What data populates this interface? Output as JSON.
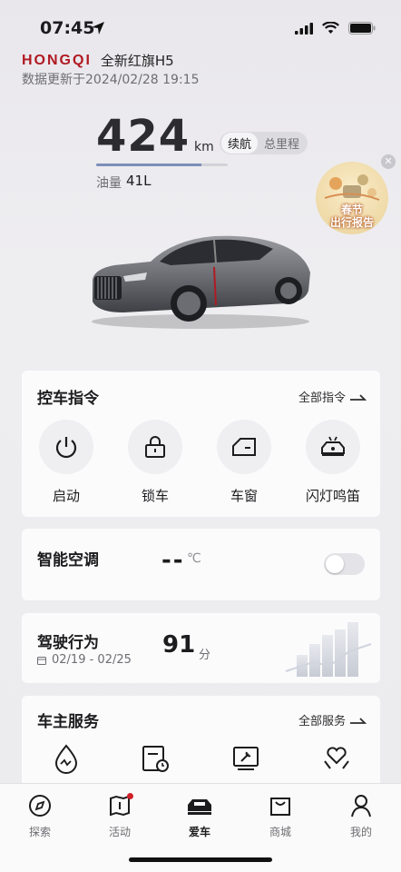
{
  "status": {
    "time": "07:45"
  },
  "header": {
    "brand": "HONGQI",
    "model": "全新红旗H5",
    "update_time": "数据更新于2024/02/28 19:15"
  },
  "range": {
    "value": "424",
    "unit": "km",
    "toggle": [
      "续航",
      "总里程"
    ],
    "active_toggle": "续航",
    "fuel_label": "油量",
    "fuel_value": "41L",
    "fuel_level": 0.8
  },
  "promo": {
    "line1": "春节",
    "line2": "出行报告"
  },
  "controls": {
    "title": "控车指令",
    "more": "全部指令",
    "items": [
      {
        "label": "启动",
        "icon": "power-icon"
      },
      {
        "label": "锁车",
        "icon": "lock-icon"
      },
      {
        "label": "车窗",
        "icon": "window-icon"
      },
      {
        "label": "闪灯鸣笛",
        "icon": "car-horn-icon"
      }
    ]
  },
  "climate": {
    "title": "智能空调",
    "temp": "--",
    "unit": "℃",
    "enabled": false
  },
  "driving": {
    "title": "驾驶行为",
    "date_range": "02/19 - 02/25",
    "score": "91",
    "score_unit": "分"
  },
  "services": {
    "title": "车主服务",
    "more": "全部服务",
    "items": [
      {
        "icon": "water-drop-icon"
      },
      {
        "icon": "calendar-clock-icon"
      },
      {
        "icon": "repair-monitor-icon"
      },
      {
        "icon": "heart-hands-icon"
      }
    ]
  },
  "tabbar": {
    "items": [
      {
        "label": "探索",
        "icon": "compass-icon"
      },
      {
        "label": "活动",
        "icon": "map-icon",
        "badge": true
      },
      {
        "label": "爱车",
        "icon": "car-icon",
        "active": true
      },
      {
        "label": "商城",
        "icon": "shop-bag-icon"
      },
      {
        "label": "我的",
        "icon": "person-icon"
      }
    ]
  }
}
